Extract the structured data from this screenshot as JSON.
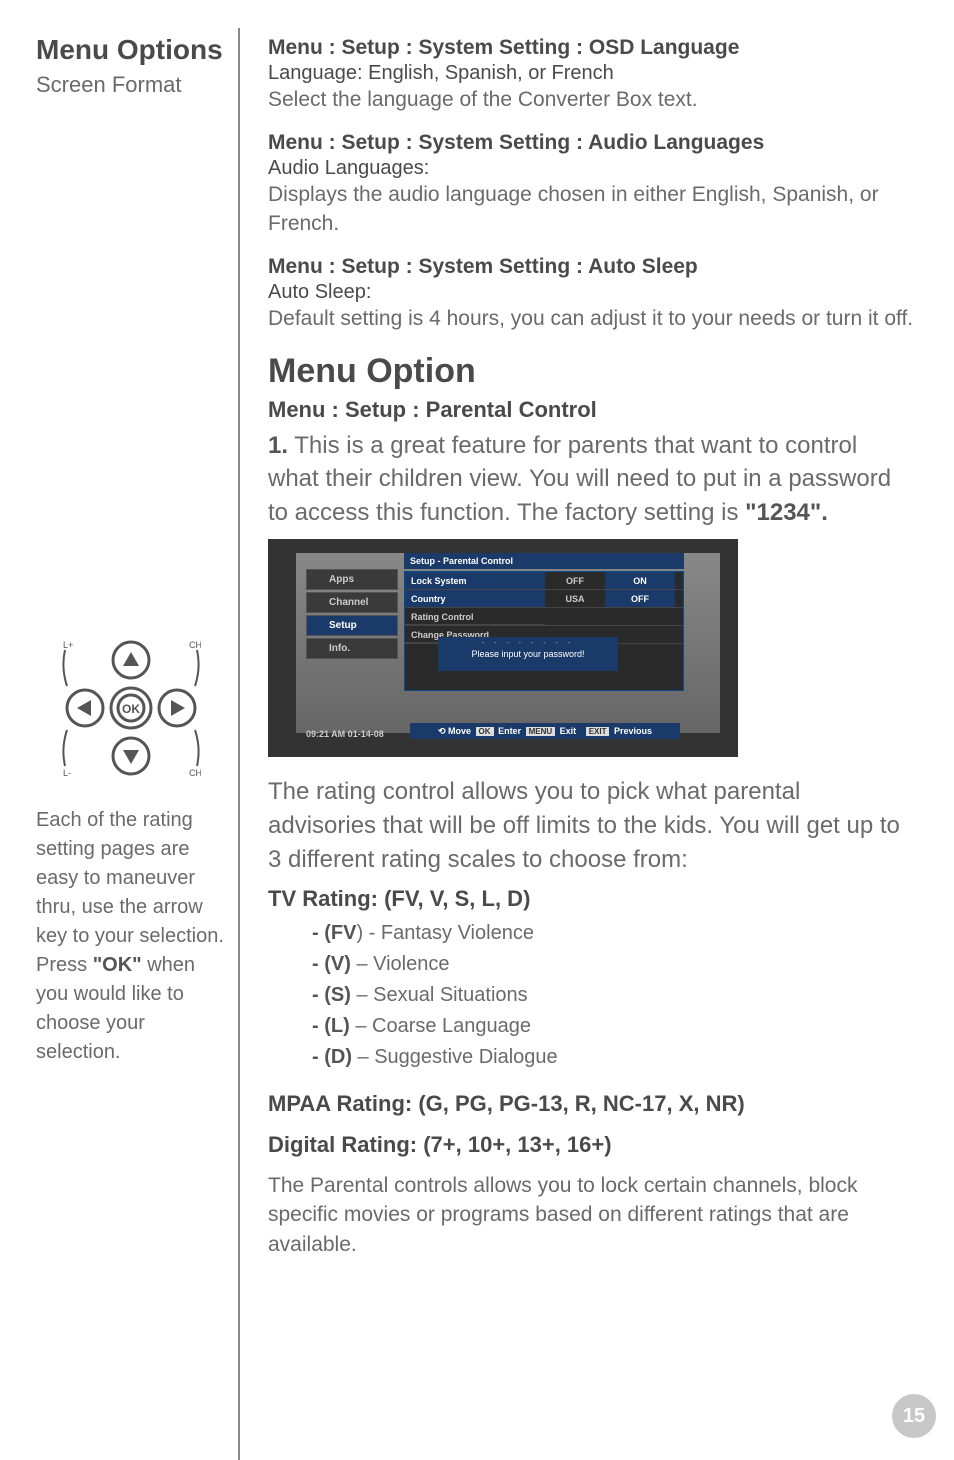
{
  "sidebar": {
    "title": "Menu Options",
    "subtitle": "Screen Format",
    "help": {
      "p1": "Each of the rating setting pages are easy to maneuver thru, use the arrow key to your selection. Press ",
      "ok": "\"OK\"",
      "p2": " when you would like to choose your selection."
    },
    "pad_labels": {
      "tl": "L+",
      "tr": "CH",
      "bl": "L-",
      "br": "CH",
      "ok": "OK"
    }
  },
  "blocks": [
    {
      "crumb": "Menu  :  Setup  :  System Setting  :  OSD Language",
      "label": "Language:",
      "val": " English, Spanish, or French",
      "body": "Select the language of the Converter Box text."
    },
    {
      "crumb": "Menu  :  Setup  :  System Setting  :  Audio Languages",
      "label": "Audio Languages:",
      "val": "",
      "body": "Displays the audio language chosen in either English, Spanish, or French."
    },
    {
      "crumb": "Menu  :  Setup  :  System Setting  :  Auto Sleep",
      "label": "Auto Sleep:",
      "val": "",
      "body": "Default setting is 4 hours, you can adjust it to your needs or turn it off."
    }
  ],
  "menu_option": {
    "title": "Menu Option",
    "crumb": "Menu  :  Setup  :  Parental Control",
    "para_pre": "1.",
    "para": " This is a great feature for parents that want to control what their children view. You will need to put in a password to access this function. The factory setting is ",
    "para_bold": "\"1234\"."
  },
  "screenshot": {
    "header": "Setup - Parental Control",
    "side_items": [
      "Apps",
      "Channel",
      "Setup",
      "Info."
    ],
    "rows": [
      {
        "label": "Lock System",
        "mid": "OFF",
        "end": "ON"
      },
      {
        "label": "Country",
        "mid": "USA",
        "end": "OFF"
      },
      {
        "label": "Rating Control",
        "mid": "",
        "end": ""
      },
      {
        "label": "Change Password",
        "mid": "",
        "end": ""
      }
    ],
    "prompt_dots": "- -  - -  - -  - -",
    "prompt": "Please input your password!",
    "timestamp": "09:21 AM 01-14-08",
    "hints": {
      "move": "Move",
      "ok": "OK",
      "enter": "Enter",
      "menu": "MENU",
      "exit": "Exit",
      "exitbtn": "EXIT",
      "prev": "Previous"
    }
  },
  "after_shot": "The rating control allows you to pick what parental advisories that will be off limits to the kids. You will get up to 3 different rating scales to choose from:",
  "tv_rating": {
    "title": "TV Rating: (FV, V, S, L, D)",
    "items": [
      {
        "code": "- (FV",
        "paren": ")",
        "desc": " - Fantasy Violence"
      },
      {
        "code": "- (V)",
        "paren": "",
        "desc": " – Violence"
      },
      {
        "code": "- (S)",
        "paren": "",
        "desc": " – Sexual Situations"
      },
      {
        "code": "- (L)",
        "paren": "",
        "desc": " – Coarse Language"
      },
      {
        "code": "- (D)",
        "paren": "",
        "desc": " – Suggestive Dialogue"
      }
    ]
  },
  "mpaa": "MPAA Rating: (G, PG, PG-13, R, NC-17, X, NR)",
  "digital": "Digital Rating: (7+, 10+, 13+, 16+)",
  "final": "The Parental controls allows you to lock certain channels, block specific movies or programs based on different ratings that are available.",
  "page_number": "15"
}
